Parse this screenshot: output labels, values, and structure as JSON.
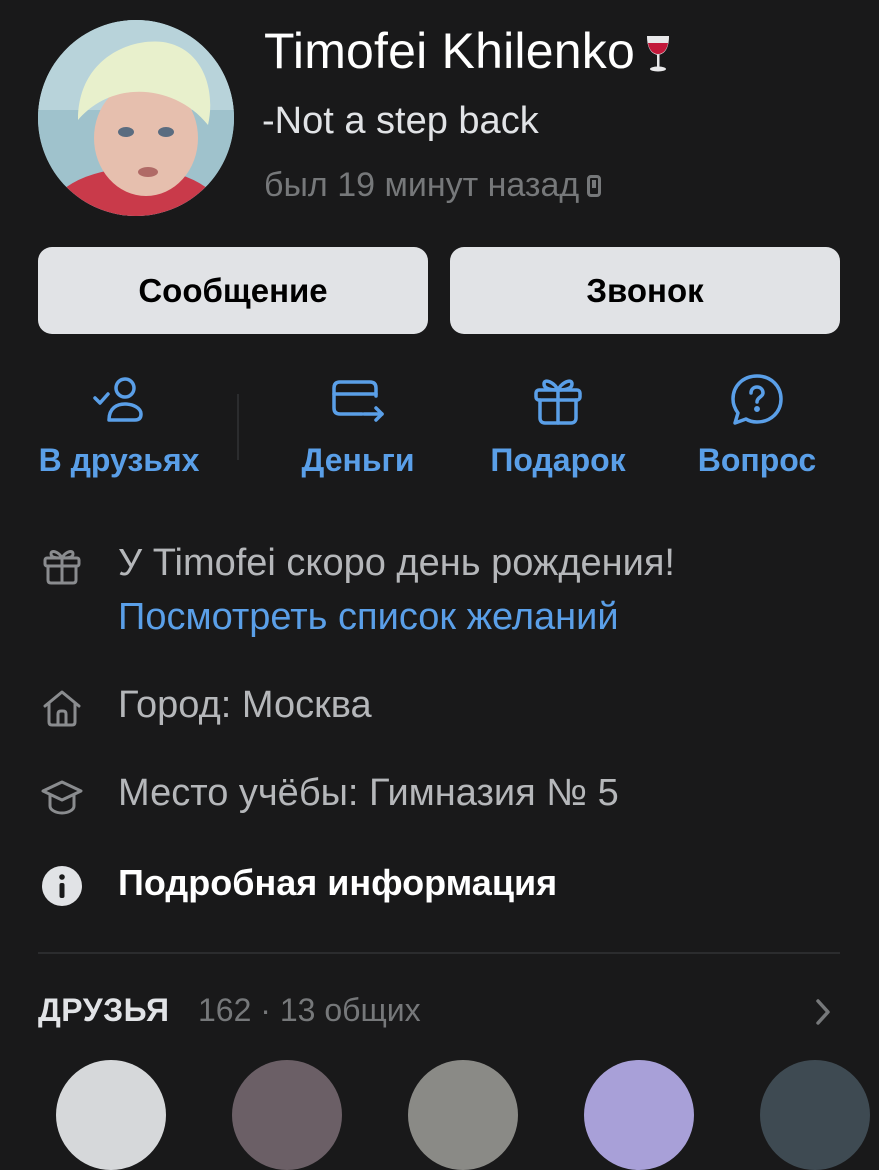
{
  "profile": {
    "name": "Timofei Khilenko",
    "status": "-Not a step back",
    "last_seen": "был 19 минут назад",
    "name_emoji": "wine-glass-icon",
    "device": "phone-icon"
  },
  "buttons": {
    "message": "Сообщение",
    "call": "Звонок"
  },
  "actions": [
    {
      "label": "В друзьях",
      "icon": "friend-check-icon"
    },
    {
      "label": "Деньги",
      "icon": "money-transfer-icon"
    },
    {
      "label": "Подарок",
      "icon": "gift-icon"
    },
    {
      "label": "Вопрос",
      "icon": "question-bubble-icon"
    }
  ],
  "info": {
    "birthday_text": "У Timofei скоро день рождения!",
    "wishlist_link": "Посмотреть список желаний",
    "city": "Город: Москва",
    "school": "Место учёбы: Гимназия № 5",
    "details": "Подробная информация"
  },
  "friends": {
    "title": "ДРУЗЬЯ",
    "count_text": "162 · 13 общих"
  },
  "colors": {
    "background": "#19191a",
    "accent": "#5a9fe8",
    "button_bg": "#e1e3e6",
    "secondary_text": "#76787a"
  }
}
